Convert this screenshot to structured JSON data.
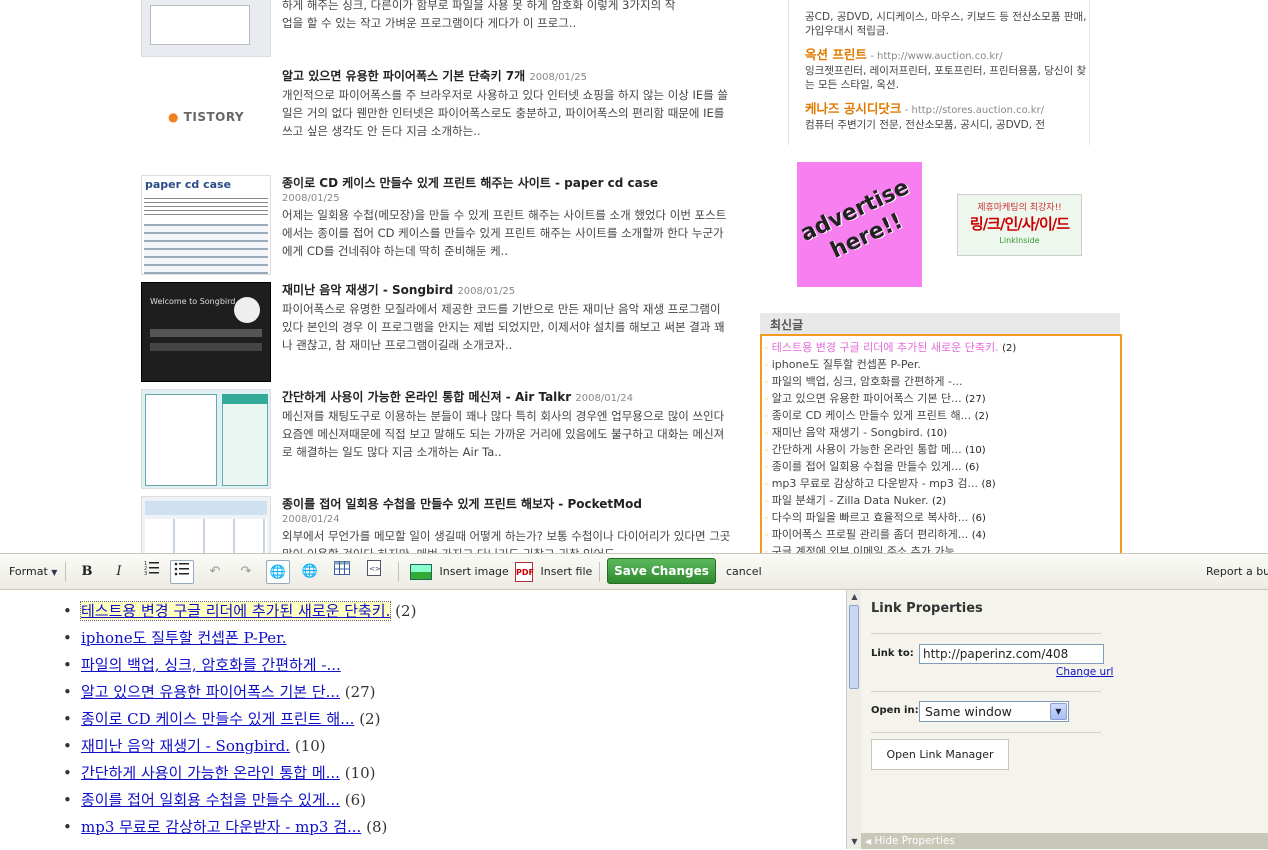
{
  "top_post": {
    "desc_line1": "하게 해주는 싱크, 다른이가 함부로 파일을 사용 못 하게 암호화 이렇게 3가지의 작",
    "desc_line2": "업을 할 수 있는 작고 가벼운 프로그램이다 게다가 이 프로그.."
  },
  "posts": [
    {
      "title": "알고 있으면 유용한 파이어폭스 기본 단축키 7개",
      "date": "2008/01/25",
      "thumb_text": "TISTORY",
      "desc": "개인적으로 파이어폭스를 주 브라우저로 사용하고 있다 인터넷 쇼핑을 하지 않는 이상 IE를 쓸 일은 거의 없다 웬만한 인터넷은 파이어폭스로도 충분하고, 파이어폭스의 편리함 때문에 IE를 쓰고 싶은 생각도 안 든다 지금 소개하는.."
    },
    {
      "title": "종이로 CD 케이스 만들수 있게 프린트 해주는 사이트 - paper cd case",
      "date": "2008/01/25",
      "thumb_text": "paper cd case",
      "desc": "어제는 일회용 수첩(메모장)을 만들 수 있게 프린트 해주는 사이트를 소개 했었다 이번 포스트에서는 종이를 접어 CD 케이스를 만들수 있게 프린트 해주는 사이트를 소개할까 한다 누군가에게 CD를 건네줘야 하는데 딱히 준비해둔 케.."
    },
    {
      "title": "재미난 음악 재생기 - Songbird",
      "date": "2008/01/25",
      "thumb_text": "Welcome to Songbird.",
      "desc": "파이어폭스로 유명한 모질라에서 제공한 코드를 기반으로 만든 재미난 음악 재생 프로그램이 있다 본인의 경우 이 프로그램을 안지는 제법 되었지만, 이제서야 설치를 해보고 써본 결과 꽤나 괜찮고, 참 재미난 프로그램이길래 소개코자.."
    },
    {
      "title": "간단하게 사용이 가능한 온라인 통합 메신져 - Air Talkr",
      "date": "2008/01/24",
      "thumb_text": "",
      "desc": "메신져를 채팅도구로 이용하는 분들이 꽤나 많다 특히 회사의 경우엔 업무용으로 많이 쓰인다 요즘엔 메신져때문에 직접 보고 말해도 되는 가까운 거리에 있음에도 불구하고 대화는 메신져로 해결하는 일도 많다 지금 소개하는 Air Ta.."
    },
    {
      "title": "종이를 접어 일회용 수첩을 만들수 있게 프린트 해보자 - PocketMod",
      "date": "2008/01/24",
      "thumb_text": "",
      "desc": "외부에서 무언가를 메모할 일이 생길때 어떻게 하는가? 보통 수첩이나 다이어리가 있다면 그곳 많이 이용할 것이다 하지만, 매번 가지고 다니기도 귀찮고 귀찮 있어도.."
    }
  ],
  "ads": [
    {
      "title": "",
      "url": "",
      "desc": "공CD, 공DVD, 시디케이스, 마우스, 키보드 등 전산소모품 판매, 가입우대시 적립금."
    },
    {
      "title": "옥션 프린트",
      "url": "- http://www.auction.co.kr/",
      "desc": "잉크젯프린터, 레이저프린터, 포토프린터, 프린터용품, 당신이 찾는 모든 스타일, 옥션."
    },
    {
      "title": "케나즈 공시디닷크",
      "url": "- http://stores.auction.co.kr/",
      "desc": "컴퓨터 주변기기 전문, 전산소모품, 공시디, 공DVD, 전"
    }
  ],
  "advertise_banner": {
    "line1": "advertise",
    "line2": "here!!"
  },
  "linkinside_banner": {
    "line1": "제휴마케팅의 최강자!!",
    "line2": "링/크/인/사/이/드",
    "line3": "LinkInside"
  },
  "recent": {
    "heading": "최신글",
    "items": [
      {
        "title": "테스트용 변경  구글 리더에 추가된 새로운 단축키.",
        "count": "(2)"
      },
      {
        "title": "iphone도 질투할 컨셉폰 P-Per.",
        "count": ""
      },
      {
        "title": "파일의 백업, 싱크, 암호화를 간편하게 -...",
        "count": ""
      },
      {
        "title": "알고 있으면 유용한 파이어폭스 기본 단...",
        "count": "(27)"
      },
      {
        "title": "종이로 CD 케이스 만들수 있게 프린트 해...",
        "count": "(2)"
      },
      {
        "title": "재미난 음악 재생기 - Songbird.",
        "count": "(10)"
      },
      {
        "title": "간단하게 사용이 가능한 온라인 통합 메...",
        "count": "(10)"
      },
      {
        "title": "종이를 접어 일회용 수첩을 만들수 있게...",
        "count": "(6)"
      },
      {
        "title": "mp3 무료로 감상하고 다운받자 - mp3 검...",
        "count": "(8)"
      },
      {
        "title": "파일 분쇄기 - Zilla Data Nuker.",
        "count": "(2)"
      },
      {
        "title": "다수의 파일을 빠르고 효율적으로 복사하...",
        "count": "(6)"
      },
      {
        "title": "파이어폭스 프로필 관리를 좀더 편리하게...",
        "count": "(4)"
      },
      {
        "title": "구글 계정에 외부 이메일 주소 추가 가능.",
        "count": ""
      },
      {
        "title": "",
        "count": ""
      }
    ]
  },
  "toolbar": {
    "format_label": "Format",
    "bold_icon": "B",
    "italic_icon": "I",
    "insert_image_label": "Insert image",
    "insert_file_label": "Insert file",
    "save_label": "Save Changes",
    "cancel_label": "cancel",
    "report_label": "Report a bug"
  },
  "editor": {
    "items": [
      {
        "title": "테스트용 변경  구글 리더에 추가된 새로운 단축키.",
        "count": "(2)"
      },
      {
        "title": "iphone도 질투할 컨셉폰 P-Per.",
        "count": ""
      },
      {
        "title": "파일의 백업, 싱크, 암호화를 간편하게 -...",
        "count": ""
      },
      {
        "title": "알고 있으면 유용한 파이어폭스 기본 단...",
        "count": "(27)"
      },
      {
        "title": "종이로 CD 케이스 만들수 있게 프린트 해...",
        "count": "(2)"
      },
      {
        "title": "재미난 음악 재생기 - Songbird.",
        "count": "(10)"
      },
      {
        "title": "간단하게 사용이 가능한 온라인 통합 메...",
        "count": "(10)"
      },
      {
        "title": "종이를 접어 일회용 수첩을 만들수 있게...",
        "count": "(6)"
      },
      {
        "title": "mp3 무료로 감상하고 다운받자 - mp3 검...",
        "count": "(8)"
      }
    ]
  },
  "link_panel": {
    "heading": "Link Properties",
    "link_to_label": "Link to:",
    "link_to_value": "http://paperinz.com/408",
    "change_url_label": "Change url",
    "open_in_label": "Open in:",
    "open_in_value": "Same window",
    "open_link_manager_label": "Open Link Manager",
    "hide_properties_label": "Hide Properties"
  },
  "colors": {
    "accent_orange": "#f39a21",
    "save_green": "#3a9a3a",
    "link_blue": "#1010c8",
    "recent_first_pink": "#e36ad8"
  }
}
